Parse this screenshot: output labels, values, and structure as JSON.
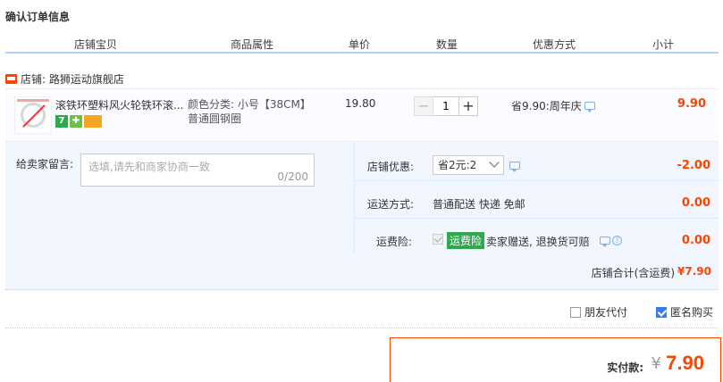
{
  "page": {
    "title": "确认订单信息"
  },
  "columns": [
    "店铺宝贝",
    "商品属性",
    "单价",
    "数量",
    "优惠方式",
    "小计"
  ],
  "shop": {
    "label": "店铺: 路狮运动旗舰店"
  },
  "item": {
    "title": "滚铁环塑料风火轮铁环滚...",
    "sku_line1": "颜色分类: 小号【38CM】",
    "sku_line2": "普通圆钢圈",
    "price": "19.80",
    "quantity": "1",
    "minus": "−",
    "plus": "+",
    "promo": "省9.90:周年庆",
    "subtotal": "9.90",
    "badges": [
      "7",
      "✚",
      ""
    ]
  },
  "message": {
    "label": "给卖家留言:",
    "placeholder": "选填,请先和商家协商一致",
    "counter": "0/200"
  },
  "shop_discount": {
    "label": "店铺优惠:",
    "selected": "省2元:2",
    "value": "-2.00"
  },
  "shipping": {
    "label": "运送方式:",
    "text": "普通配送 快递 免邮",
    "value": "0.00"
  },
  "insurance": {
    "label": "运费险:",
    "tag": "运费险",
    "text": "卖家赠送, 退换货可赔",
    "value": "0.00"
  },
  "shop_total": {
    "label": "店铺合计(含运费)",
    "value": "¥7.90"
  },
  "options": {
    "friend_pay": "朋友代付",
    "anonymous": "匿名购买",
    "friend_pay_checked": false,
    "anonymous_checked": true
  },
  "payment": {
    "label": "实付款:",
    "currency": "¥",
    "amount": "7.90"
  },
  "colors": {
    "accent": "#ff4400",
    "header_border": "#b2d1ff",
    "box_bg": "#f2f7ff",
    "green": "#2fa84f"
  }
}
